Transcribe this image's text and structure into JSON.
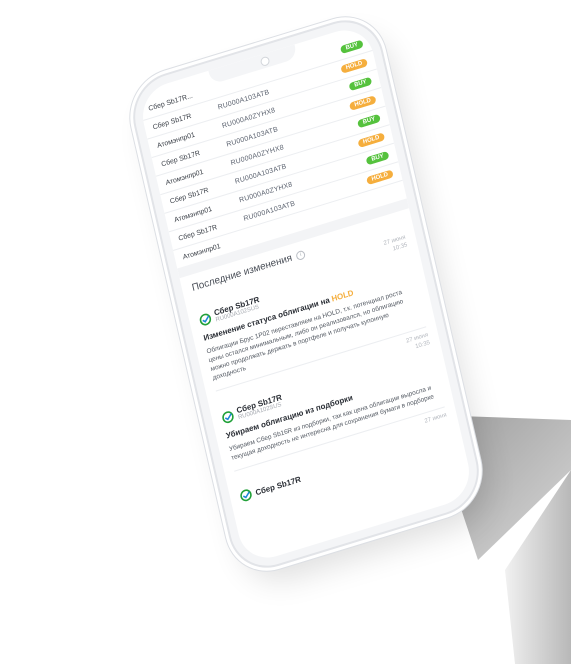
{
  "rows": [
    {
      "name": "Сбер Sb17R...",
      "isin": "",
      "status": "BUY",
      "kind": "buy"
    },
    {
      "name": "Сбер Sb17R",
      "isin": "RU000A103ATB",
      "status": "HOLD",
      "kind": "hold"
    },
    {
      "name": "Атомэнпр01",
      "isin": "RU000A0ZYHX8",
      "status": "BUY",
      "kind": "buy"
    },
    {
      "name": "Сбер Sb17R",
      "isin": "RU000A103ATB",
      "status": "HOLD",
      "kind": "hold"
    },
    {
      "name": "Атомэнпр01",
      "isin": "RU000A0ZYHX8",
      "status": "BUY",
      "kind": "buy"
    },
    {
      "name": "Сбер Sb17R",
      "isin": "RU000A103ATB",
      "status": "HOLD",
      "kind": "hold"
    },
    {
      "name": "Атомэнпр01",
      "isin": "RU000A0ZYHX8",
      "status": "BUY",
      "kind": "buy"
    },
    {
      "name": "Сбер Sb17R",
      "isin": "RU000A103ATB",
      "status": "HOLD",
      "kind": "hold"
    },
    {
      "name": "Атомэнпр01",
      "isin": "",
      "status": "",
      "kind": ""
    }
  ],
  "changes": {
    "title": "Последние изменения",
    "info_glyph": "i",
    "cards": [
      {
        "date": "27 июня",
        "time": "10:35",
        "bond_name": "Сбер Sb17R",
        "bond_isin": "RU000A102SUS",
        "title": "Изменение статуса облигации на",
        "title_status": "HOLD",
        "text": "Облигации Брус 1P02 переставляем на HOLD, т.к. потенциал роста цены остался минимальным, либо он реализовался, но облигацию можно продолжать держать в портфеле и получать купонную доходность"
      },
      {
        "date": "27 июня",
        "time": "10:35",
        "bond_name": "Сбер Sb17R",
        "bond_isin": "RU000A102SUS",
        "title": "Убираем облигацию из подборки",
        "title_status": "",
        "text": "Убираем Сбер Sb16R из подборки, так как цена облигации выросла и текущая доходность не интересна для сохранения бумаги в подборке"
      },
      {
        "date": "27 июня",
        "time": "",
        "bond_name": "Сбер Sb17R",
        "bond_isin": "",
        "title": "",
        "title_status": "",
        "text": ""
      }
    ]
  },
  "colors": {
    "buy": "#55c23d",
    "hold": "#f5ae3d",
    "logo_green": "#21a038",
    "logo_blue": "#1e88d6"
  }
}
